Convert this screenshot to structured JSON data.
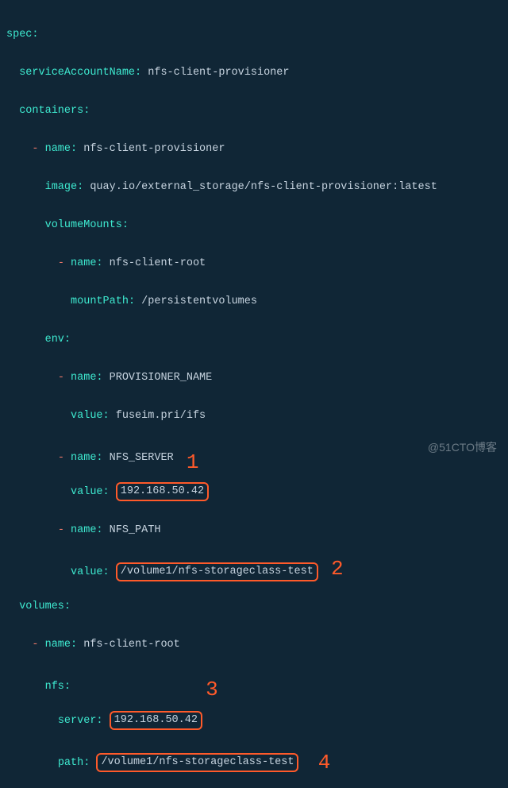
{
  "lines": {
    "l1_key": "spec",
    "l1_colon": ":",
    "l2_key": "serviceAccountName",
    "l2_colon": ":",
    "l2_val": " nfs-client-provisioner",
    "l3_key": "containers",
    "l3_colon": ":",
    "l4_dash": "- ",
    "l4_key": "name",
    "l4_colon": ":",
    "l4_val": " nfs-client-provisioner",
    "l5_key": "image",
    "l5_colon": ":",
    "l5_val": " quay.io/external_storage/nfs-client-provisioner:latest",
    "l6_key": "volumeMounts",
    "l6_colon": ":",
    "l7_dash": "- ",
    "l7_key": "name",
    "l7_colon": ":",
    "l7_val": " nfs-client-root",
    "l8_key": "mountPath",
    "l8_colon": ":",
    "l8_val": " /persistentvolumes",
    "l9_key": "env",
    "l9_colon": ":",
    "l10_dash": "- ",
    "l10_key": "name",
    "l10_colon": ":",
    "l10_val": " PROVISIONER_NAME",
    "l11_key": "value",
    "l11_colon": ":",
    "l11_val": " fuseim.pri/ifs",
    "l12_dash": "- ",
    "l12_key": "name",
    "l12_colon": ":",
    "l12_val": " NFS_SERVER",
    "l13_key": "value",
    "l13_colon": ":",
    "l13_box": "192.168.50.42",
    "l14_dash": "- ",
    "l14_key": "name",
    "l14_colon": ":",
    "l14_val": " NFS_PATH",
    "l15_key": "value",
    "l15_colon": ":",
    "l15_box": "/volume1/nfs-storageclass-test",
    "l16_key": "volumes",
    "l16_colon": ":",
    "l17_dash": "- ",
    "l17_key": "name",
    "l17_colon": ":",
    "l17_val": " nfs-client-root",
    "l18_key": "nfs",
    "l18_colon": ":",
    "l19_key": "server",
    "l19_colon": ":",
    "l19_box": "192.168.50.42",
    "l20_key": "path",
    "l20_colon": ":",
    "l20_box": "/volume1/nfs-storageclass-test"
  },
  "annotations": {
    "n1": "1",
    "n2": "2",
    "n3": "3",
    "n4": "4"
  },
  "watermark": "@51CTO博客"
}
